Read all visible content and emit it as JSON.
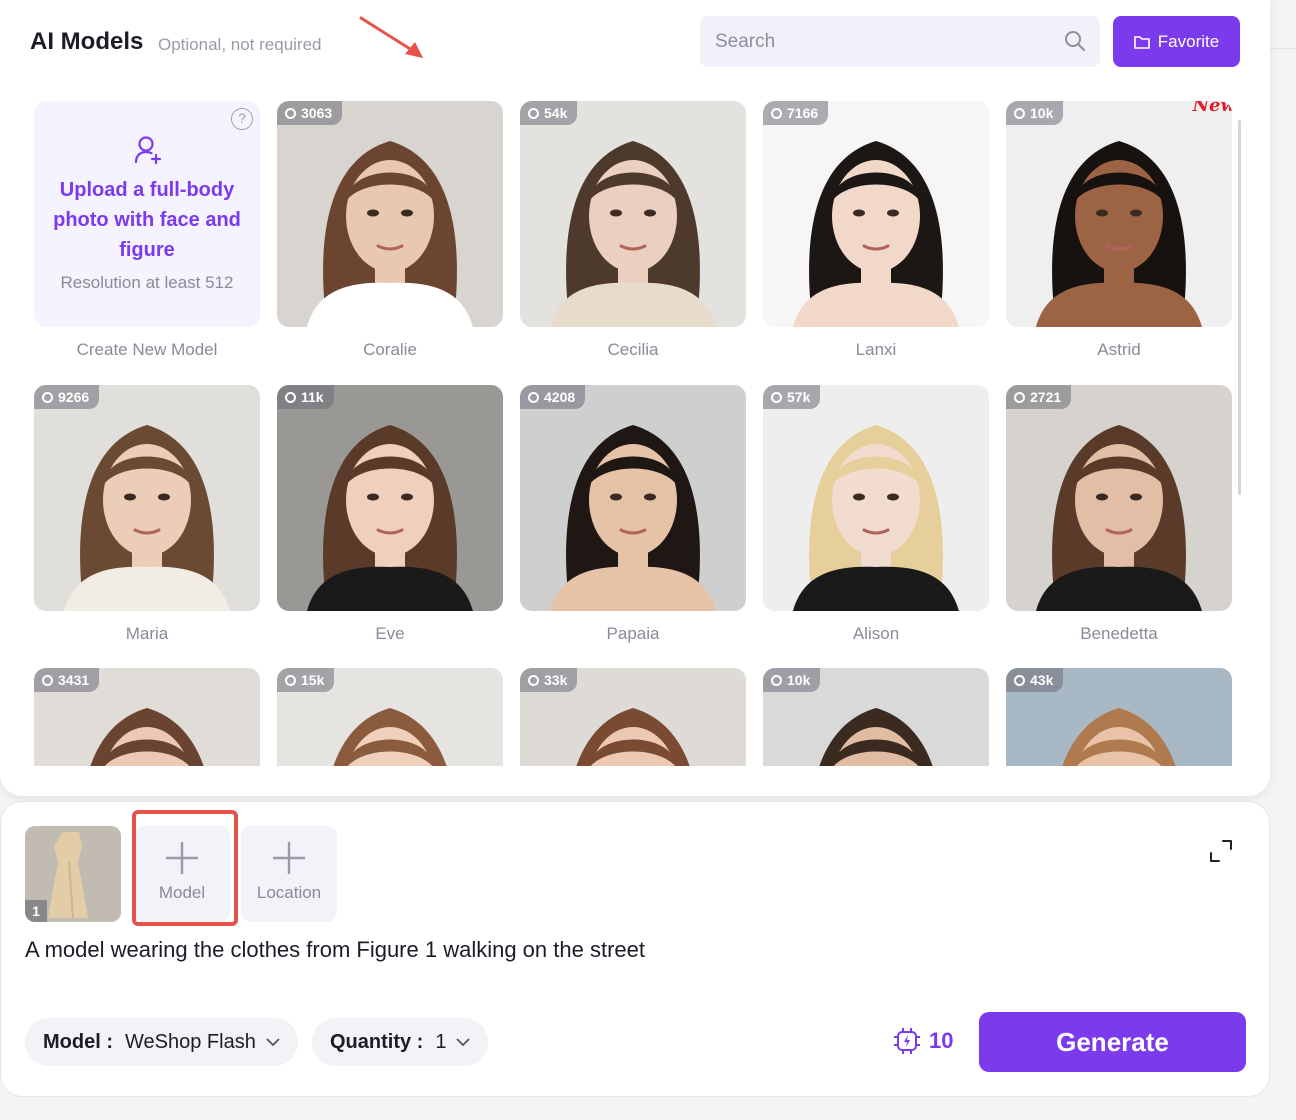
{
  "header": {
    "title": "AI Models",
    "subtitle": "Optional, not required",
    "search_placeholder": "Search",
    "favorite_label": "Favorite"
  },
  "upload_card": {
    "help": "?",
    "text": "Upload a full-body photo with face and figure",
    "resolution": "Resolution at least 512",
    "label": "Create New Model"
  },
  "models": [
    {
      "name": "Coralie",
      "count": "3063",
      "hair": "#6b4530",
      "skin": "#e9c8b2",
      "bg": "#d8d4cf",
      "shirt": "#ffffff"
    },
    {
      "name": "Cecilia",
      "count": "54k",
      "hair": "#4e3a2c",
      "skin": "#ecd0bf",
      "bg": "#e4e2de",
      "shirt": "#e7dccb"
    },
    {
      "name": "Lanxi",
      "count": "7166",
      "hair": "#1c1614",
      "skin": "#f1d8c9",
      "bg": "#f6f6f6",
      "shirt": "#f1d8c9"
    },
    {
      "name": "Astrid",
      "count": "10k",
      "hair": "#17110f",
      "skin": "#9c6444",
      "bg": "#efefef",
      "shirt": "#9c6444",
      "is_new": true,
      "new_label": "New"
    },
    {
      "name": "Maria",
      "count": "9266",
      "hair": "#6b4a33",
      "skin": "#ebcdb8",
      "bg": "#e1dfdc",
      "shirt": "#f1ede4"
    },
    {
      "name": "Eve",
      "count": "11k",
      "hair": "#5a3a29",
      "skin": "#efd0be",
      "bg": "#9a9895",
      "shirt": "#1a1a1a"
    },
    {
      "name": "Papaia",
      "count": "4208",
      "hair": "#1e1714",
      "skin": "#e6c2a6",
      "bg": "#cfcfcf",
      "shirt": "#e6c2a6"
    },
    {
      "name": "Alison",
      "count": "57k",
      "hair": "#e6cf9a",
      "skin": "#f1dccf",
      "bg": "#eeeeee",
      "shirt": "#1a1a1a"
    },
    {
      "name": "Benedetta",
      "count": "2721",
      "hair": "#5a3a28",
      "skin": "#e3bea6",
      "bg": "#d6d2cd",
      "shirt": "#1a1a1a"
    },
    {
      "name": "",
      "count": "3431",
      "hair": "#6a4331",
      "skin": "#ecc9b6",
      "bg": "#e0dcd8",
      "shirt": "#ffffff"
    },
    {
      "name": "",
      "count": "15k",
      "hair": "#8a5b3c",
      "skin": "#efd0bc",
      "bg": "#e6e4e1",
      "shirt": "#ffffff"
    },
    {
      "name": "",
      "count": "33k",
      "hair": "#7a4a32",
      "skin": "#edc9b4",
      "bg": "#dedbd7",
      "shirt": "#ffffff"
    },
    {
      "name": "",
      "count": "10k",
      "hair": "#3a2a20",
      "skin": "#e1bca2",
      "bg": "#d9d9d9",
      "shirt": "#ffffff"
    },
    {
      "name": "",
      "count": "43k",
      "hair": "#b07a4f",
      "skin": "#e8c3a8",
      "bg": "#a8b8c4",
      "shirt": "#ffffff"
    }
  ],
  "composer": {
    "figure_number": "1",
    "model_slot_label": "Model",
    "location_slot_label": "Location",
    "prompt": "A model wearing the clothes from Figure 1 walking on the street",
    "model_label": "Model :",
    "model_value": "WeShop Flash",
    "quantity_label": "Quantity :",
    "quantity_value": "1",
    "credits": "10",
    "generate_label": "Generate"
  },
  "colors": {
    "accent": "#7c3aed",
    "highlight": "#e5534b"
  }
}
